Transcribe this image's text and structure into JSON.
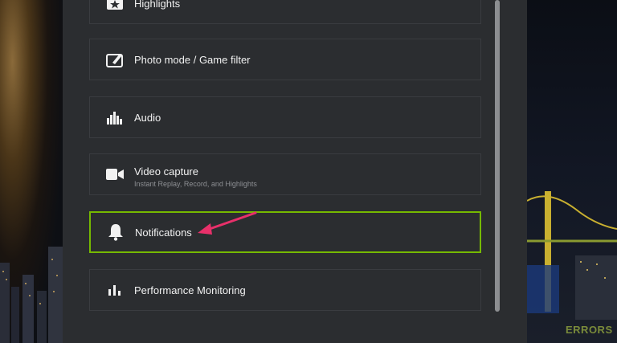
{
  "settings": {
    "items": [
      {
        "label": "Highlights",
        "icon": "highlights-icon"
      },
      {
        "label": "Photo mode / Game filter",
        "icon": "photo-mode-icon"
      },
      {
        "label": "Audio",
        "icon": "audio-icon"
      },
      {
        "label": "Video capture",
        "subtitle": "Instant Replay, Record, and Highlights",
        "icon": "video-camera-icon"
      },
      {
        "label": "Notifications",
        "icon": "bell-icon",
        "selected": true
      },
      {
        "label": "Performance Monitoring",
        "icon": "bar-chart-icon"
      }
    ]
  },
  "watermark": "ERRORS",
  "colors": {
    "panel": "#2b2d30",
    "item_border": "#3a3c40",
    "selected_border": "#76b900",
    "arrow": "#e8306a",
    "text": "#f2f2f2",
    "subtext": "#8d8f93"
  }
}
